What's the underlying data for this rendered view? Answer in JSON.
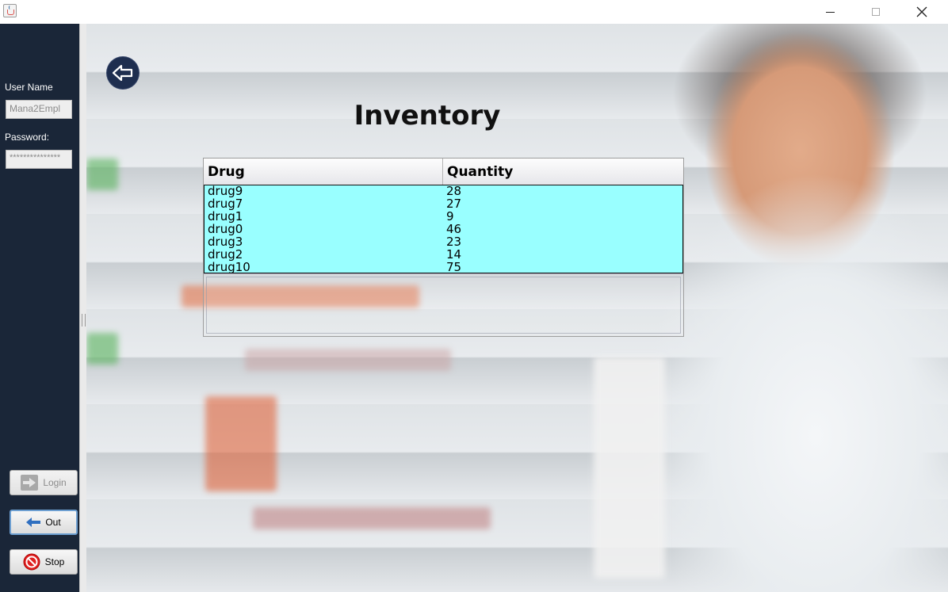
{
  "window": {
    "app_icon": "java-cup-icon",
    "controls": [
      "minimize-icon",
      "maximize-icon",
      "close-icon"
    ]
  },
  "login": {
    "username_label": "User Name",
    "username_value": "Mana2Empl",
    "password_label": "Password:",
    "password_value": "***************",
    "login_button": "Login",
    "out_button": "Out",
    "stop_button": "Stop"
  },
  "page": {
    "title": "Inventory",
    "back_icon": "back-arrow-icon"
  },
  "table": {
    "columns": [
      "Drug",
      "Quantity"
    ],
    "rows": [
      {
        "drug": "drug9",
        "quantity": "28"
      },
      {
        "drug": "drug7",
        "quantity": "27"
      },
      {
        "drug": "drug1",
        "quantity": "9"
      },
      {
        "drug": "drug0",
        "quantity": "46"
      },
      {
        "drug": "drug3",
        "quantity": "23"
      },
      {
        "drug": "drug2",
        "quantity": "14"
      },
      {
        "drug": "drug10",
        "quantity": "75"
      }
    ],
    "selection_color": "#99ffff"
  },
  "colors": {
    "sidebar": "#1a2638",
    "back_button": "#1e2e4f"
  }
}
